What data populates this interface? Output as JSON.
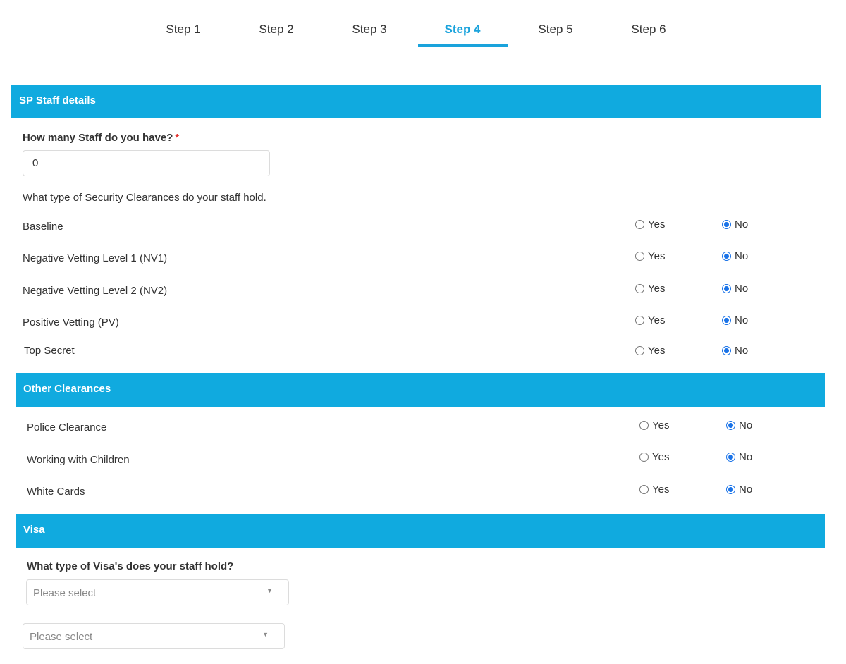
{
  "stepper": {
    "steps": [
      "Step 1",
      "Step 2",
      "Step 3",
      "Step 4",
      "Step 5",
      "Step 6"
    ],
    "active_index": 3,
    "accent_color": "#1aa3dc"
  },
  "sp_staff": {
    "header": "SP Staff details",
    "staff_count_label": "How many Staff do you have?",
    "required_mark": "*",
    "staff_count_value": "0",
    "clearance_question": "What type of Security Clearances do your staff hold.",
    "options": {
      "yes": "Yes",
      "no": "No"
    },
    "rows": [
      {
        "label": "Baseline",
        "selected": "No"
      },
      {
        "label": "Negative Vetting Level 1 (NV1)",
        "selected": "No"
      },
      {
        "label": "Negative Vetting Level 2 (NV2)",
        "selected": "No"
      },
      {
        "label": "Positive Vetting (PV)",
        "selected": "No"
      },
      {
        "label": "Top Secret",
        "selected": "No"
      }
    ]
  },
  "other_clearances": {
    "header": "Other Clearances",
    "rows": [
      {
        "label": "Police Clearance",
        "selected": "No"
      },
      {
        "label": "Working with Children",
        "selected": "No"
      },
      {
        "label": "White Cards",
        "selected": "No"
      }
    ]
  },
  "visa": {
    "header": "Visa",
    "question": "What type of Visa's does your staff hold?",
    "select_1_placeholder": "Please select",
    "select_2_placeholder": "Please select",
    "caret_icon": "▼"
  },
  "colors": {
    "section_header_bg": "#10aadf",
    "radio_checked": "#1a73e8",
    "required": "#e53935"
  }
}
